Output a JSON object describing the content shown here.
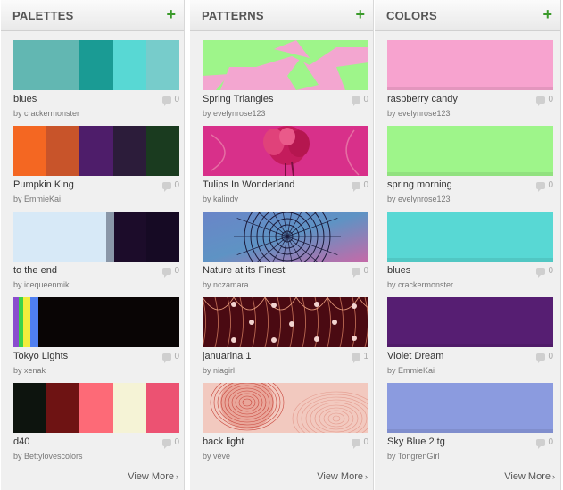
{
  "columns": [
    {
      "title": "PALETTES",
      "add_label": "+",
      "view_more": "View More",
      "items": [
        {
          "name": "blues",
          "by": "by crackermonster",
          "comments": "0",
          "colors": [
            "#62b7b2",
            "#1a9b94",
            "#58d8d4",
            "#77cccb"
          ],
          "widths": [
            40,
            20,
            20,
            20
          ]
        },
        {
          "name": "Pumpkin King",
          "by": "by EmmieKai",
          "comments": "0",
          "colors": [
            "#f46722",
            "#c8542a",
            "#4e1d6a",
            "#2c1c3a",
            "#1a3b1f"
          ],
          "widths": [
            20,
            20,
            20,
            20,
            20
          ]
        },
        {
          "name": "to the end",
          "by": "by icequeenmiki",
          "comments": "0",
          "colors": [
            "#d7e9f7",
            "#8a97a8",
            "#1c0c2a",
            "#160a24"
          ],
          "widths": [
            56,
            5,
            19,
            20
          ]
        },
        {
          "name": "Tokyo Lights",
          "by": "by xenak",
          "comments": "0",
          "colors": [
            "#8b4dce",
            "#3bd24a",
            "#f2ed3c",
            "#4f7ff0",
            "#090505"
          ],
          "widths": [
            3,
            3,
            4,
            5,
            85
          ]
        },
        {
          "name": "d40",
          "by": "by Bettylovescolors",
          "comments": "0",
          "colors": [
            "#0d140e",
            "#6e1313",
            "#fd6a77",
            "#f5f3d6",
            "#ec5272"
          ],
          "widths": [
            20,
            20,
            20,
            20,
            20
          ]
        }
      ]
    },
    {
      "title": "PATTERNS",
      "add_label": "+",
      "view_more": "View More",
      "items": [
        {
          "name": "Spring Triangles",
          "by": "by evelynrose123",
          "comments": "0",
          "pattern": "triangles"
        },
        {
          "name": "Tulips In Wonderland",
          "by": "by kalindy",
          "comments": "0",
          "pattern": "tulips"
        },
        {
          "name": "Nature at its Finest",
          "by": "by nczamara",
          "comments": "0",
          "pattern": "mandala"
        },
        {
          "name": "januarina 1",
          "by": "by niagirl",
          "comments": "1",
          "pattern": "januarina"
        },
        {
          "name": "back light",
          "by": "by vévé",
          "comments": "0",
          "pattern": "backlight"
        }
      ]
    },
    {
      "title": "COLORS",
      "add_label": "+",
      "view_more": "View More",
      "items": [
        {
          "name": "raspberry candy",
          "by": "by evelynrose123",
          "comments": "0",
          "color": "#f7a3cf"
        },
        {
          "name": "spring morning",
          "by": "by evelynrose123",
          "comments": "0",
          "color": "#9ef58a"
        },
        {
          "name": "blues",
          "by": "by crackermonster",
          "comments": "0",
          "color": "#58d8d4"
        },
        {
          "name": "Violet Dream",
          "by": "by EmmieKai",
          "comments": "0",
          "color": "#561e72"
        },
        {
          "name": "Sky Blue 2 tg",
          "by": "by TongrenGirl",
          "comments": "0",
          "color": "#8b9bdf"
        }
      ]
    }
  ]
}
